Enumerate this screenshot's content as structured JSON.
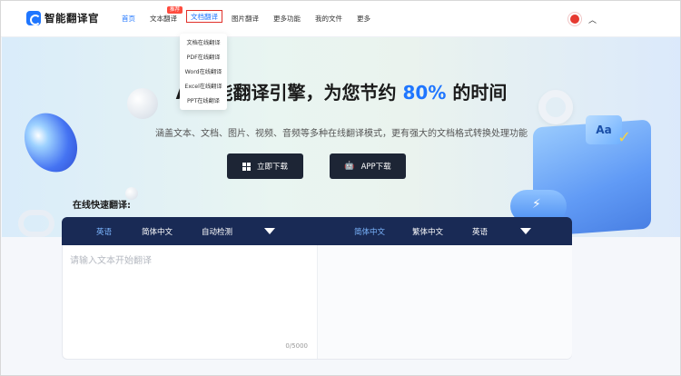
{
  "header": {
    "logo_text": "智能翻译官",
    "nav": [
      {
        "label": "首页",
        "active": true
      },
      {
        "label": "文本翻译"
      },
      {
        "label": "文档翻译",
        "outlined": true
      },
      {
        "label": "图片翻译"
      },
      {
        "label": "更多功能"
      },
      {
        "label": "我的文件"
      },
      {
        "label": "更多"
      }
    ],
    "badge": "推荐"
  },
  "dropdown": {
    "items": [
      "文档在线翻译",
      "PDF在线翻译",
      "Word在线翻译",
      "Excel在线翻译",
      "PPT在线翻译"
    ]
  },
  "hero": {
    "title_prefix": "AI智能翻译引擎，为您节约",
    "title_accent": "80%",
    "title_suffix": "的时间",
    "subtitle": "涵盖文本、文档、图片、视频、音频等多种在线翻译模式，更有强大的文档格式转换处理功能",
    "download_label": "立即下载",
    "app_label": "APP下载",
    "card_text": "Aa"
  },
  "translator": {
    "title": "在线快速翻译:",
    "source_langs": [
      "英语",
      "简体中文",
      "自动检测"
    ],
    "target_langs": [
      "简体中文",
      "繁体中文",
      "英语"
    ],
    "placeholder": "请输入文本开始翻译",
    "counter": "0/5000"
  },
  "colors": {
    "accent": "#1f76ff",
    "bar": "#192a55",
    "selected_lang": "#7cb6ff",
    "badge": "#ff4b3e",
    "outline": "#e0302a"
  }
}
